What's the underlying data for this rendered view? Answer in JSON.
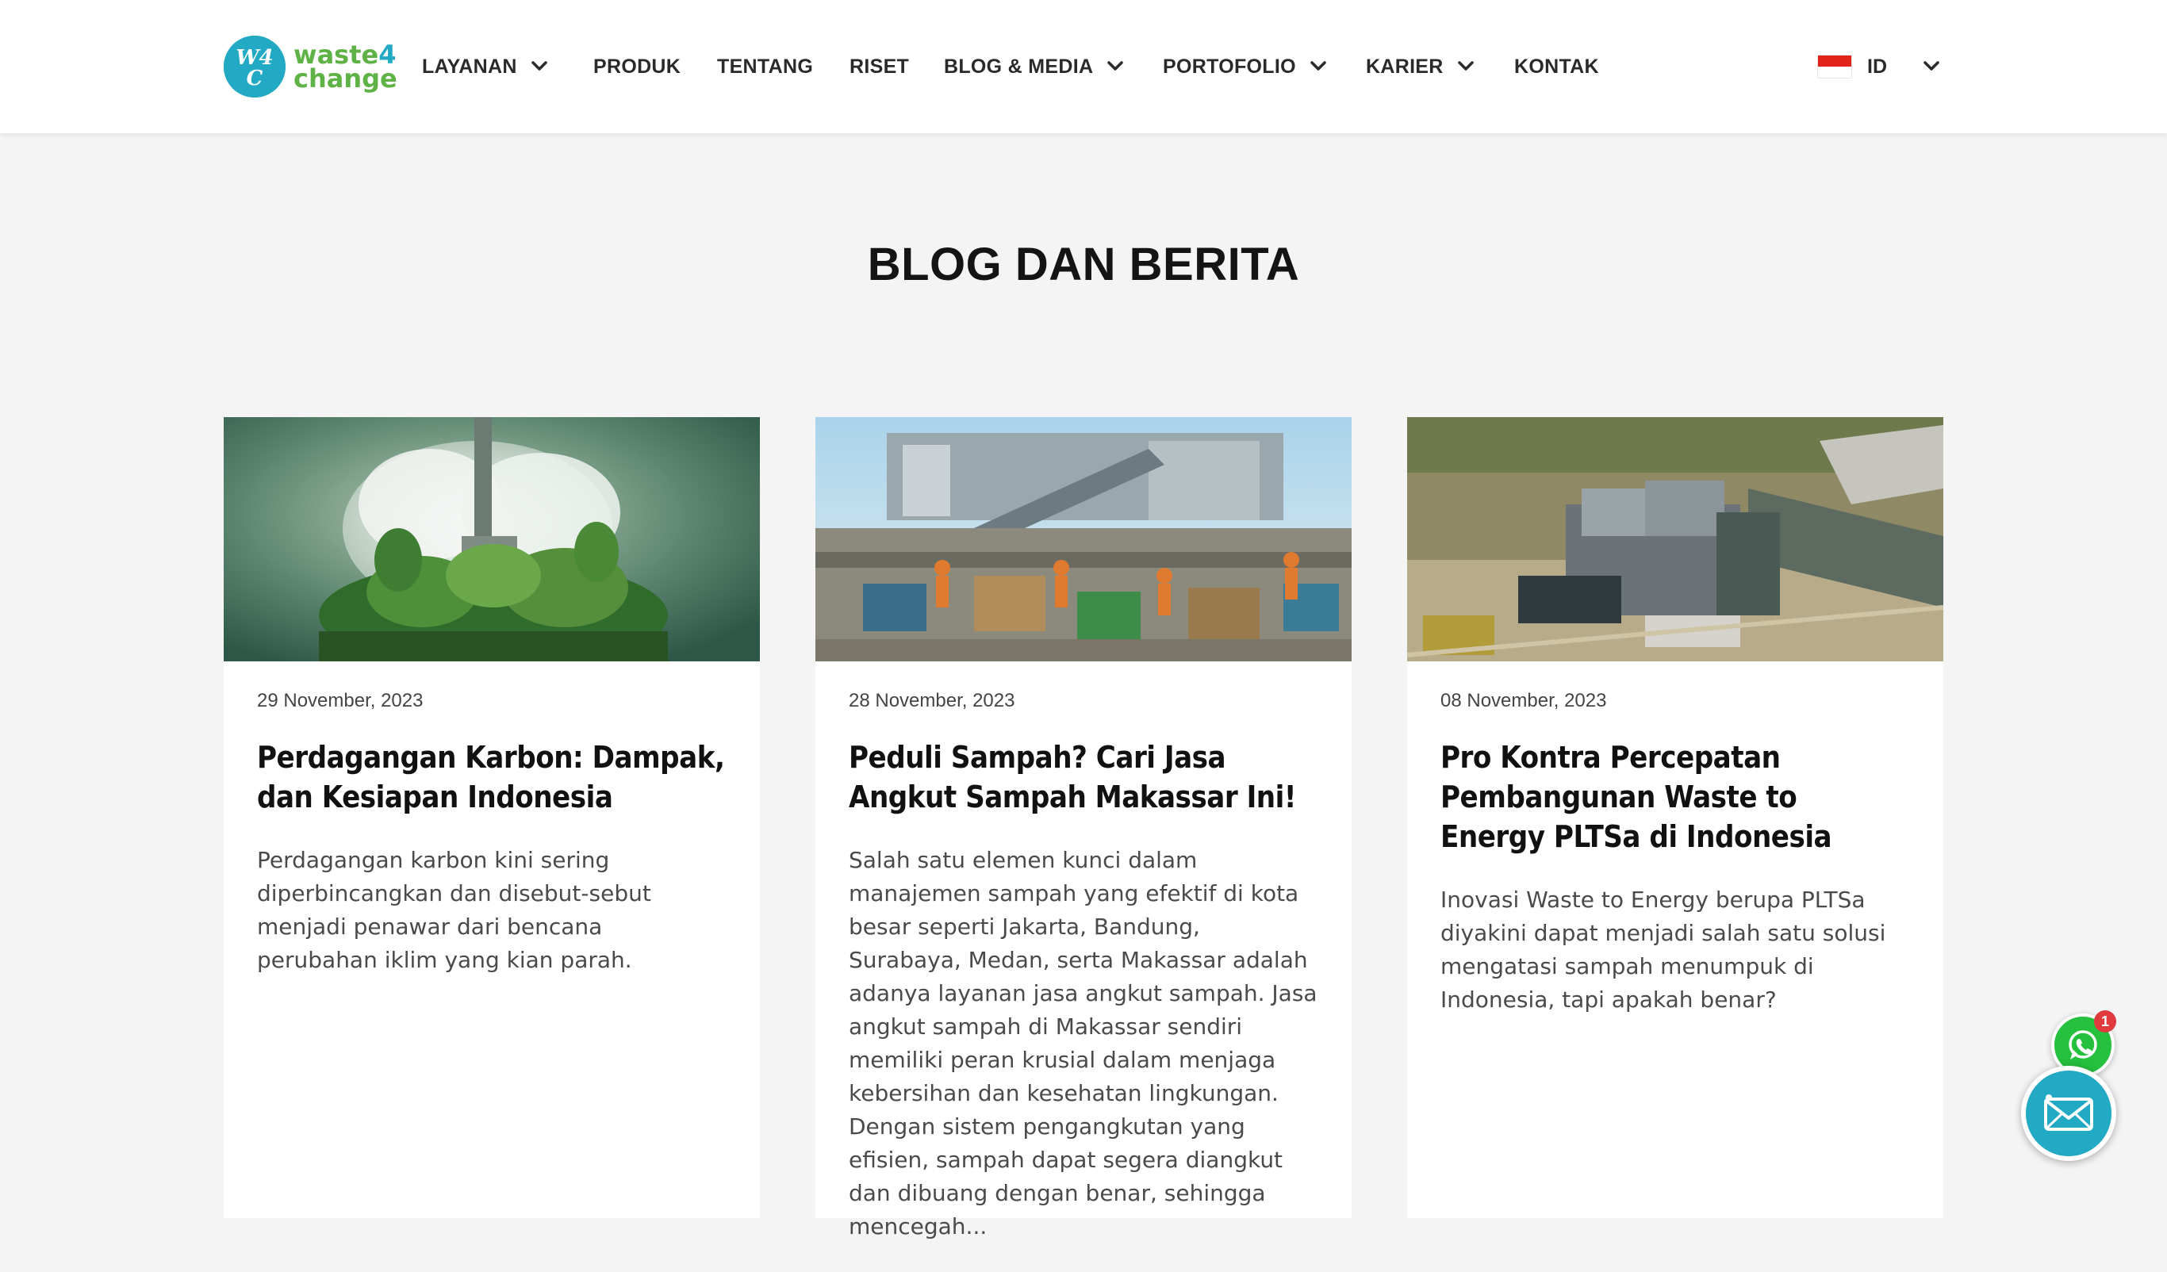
{
  "brand": {
    "badge_text": "W4C",
    "name_line1": "waste",
    "name_num": "4",
    "name_line2": "change",
    "colors": {
      "teal": "#22a9c4",
      "green": "#5fb246"
    }
  },
  "nav": {
    "layanan": "LAYANAN",
    "produk": "PRODUK",
    "tentang": "TENTANG",
    "riset": "RISET",
    "blog_media": "BLOG & MEDIA",
    "portofolio": "PORTOFOLIO",
    "karier": "KARIER",
    "kontak": "KONTAK"
  },
  "language": {
    "code": "ID",
    "flag": "indonesia-flag"
  },
  "page": {
    "title": "BLOG DAN BERITA"
  },
  "posts": [
    {
      "date": "29 November, 2023",
      "title": "Perdagangan Karbon: Dampak, dan Kesiapan Indonesia",
      "excerpt": "Perdagangan karbon kini sering diperbincangkan dan disebut-sebut menjadi penawar dari bencana perubahan iklim yang kian parah.",
      "image": "green-factory-cloud-image"
    },
    {
      "date": "28 November, 2023",
      "title": "Peduli Sampah? Cari Jasa Angkut Sampah Makassar Ini!",
      "excerpt": "Salah satu elemen kunci dalam manajemen sampah yang efektif di kota besar seperti Jakarta, Bandung, Surabaya, Medan, serta Makassar adalah adanya layanan jasa angkut sampah. Jasa angkut sampah di Makassar sendiri memiliki peran krusial dalam menjaga kebersihan dan kesehatan lingkungan. Dengan sistem pengangkutan yang efisien, sampah dapat segera diangkut dan dibuang dengan benar, sehingga mencegah...",
      "image": "waste-sorting-facility-image"
    },
    {
      "date": "08 November, 2023",
      "title": "Pro Kontra Percepatan Pembangunan Waste to Energy PLTSa di Indonesia",
      "excerpt": "Inovasi Waste to Energy berupa PLTSa diyakini dapat menjadi salah satu solusi mengatasi sampah menumpuk di Indonesia, tapi apakah benar?",
      "image": "power-plant-aerial-image"
    }
  ],
  "floating": {
    "whatsapp_badge": "1",
    "whatsapp_icon": "whatsapp-icon",
    "mail_icon": "mail-icon"
  }
}
